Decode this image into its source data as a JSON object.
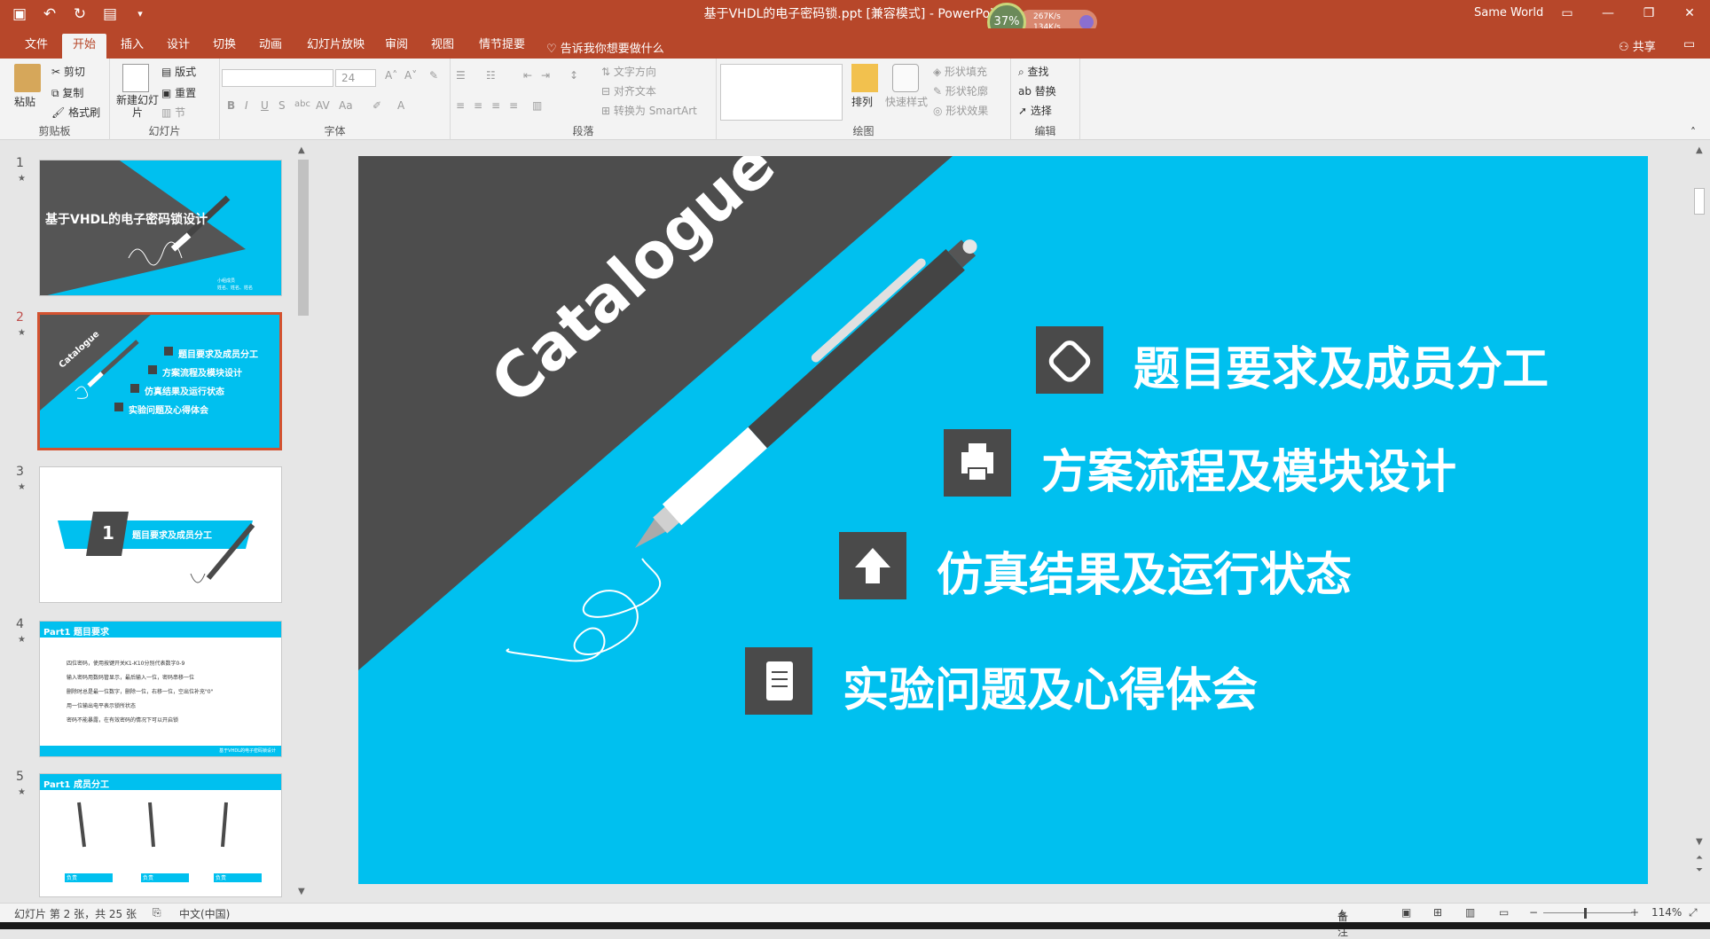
{
  "window": {
    "title": "基于VHDL的电子密码锁.ppt [兼容模式]  -  PowerPoint",
    "user": "Same World",
    "speed": {
      "percent": "37%",
      "up": "267K/s",
      "down": "134K/s"
    }
  },
  "tabs": [
    "文件",
    "开始",
    "插入",
    "设计",
    "切换",
    "动画",
    "幻灯片放映",
    "审阅",
    "视图",
    "情节提要"
  ],
  "active_tab": "开始",
  "tell_me": "告诉我你想要做什么",
  "share": "共享",
  "ribbon": {
    "clipboard": {
      "label": "剪贴板",
      "paste": "粘贴",
      "cut": "剪切",
      "copy": "复制",
      "format": "格式刷"
    },
    "slides": {
      "label": "幻灯片",
      "new_slide": "新建幻灯片",
      "layout": "版式",
      "reset": "重置",
      "section": "节"
    },
    "font": {
      "label": "字体",
      "size": "24"
    },
    "paragraph": {
      "label": "段落",
      "text_dir": "文字方向",
      "align_text": "对齐文本",
      "smartart": "转换为 SmartArt"
    },
    "drawing": {
      "label": "绘图",
      "arrange": "排列",
      "quick_styles": "快速样式",
      "fill": "形状填充",
      "outline": "形状轮廓",
      "effects": "形状效果"
    },
    "editing": {
      "label": "编辑",
      "find": "查找",
      "replace": "替换",
      "select": "选择"
    }
  },
  "thumbnails": [
    {
      "num": "1",
      "title": "基于VHDL的电子密码锁设计",
      "sub1": "小组成员",
      "sub2": "姓名、姓名、姓名"
    },
    {
      "num": "2",
      "label": "Catalogue",
      "items": [
        "题目要求及成员分工",
        "方案流程及模块设计",
        "仿真结果及运行状态",
        "实验问题及心得体会"
      ]
    },
    {
      "num": "3",
      "badge": "1",
      "title": "题目要求及成员分工"
    },
    {
      "num": "4",
      "header": "Part1 题目要求",
      "bullets": [
        "四位密码，使用按键开关K1-K10分别代表数字0-9",
        "输入密码用数码管显示，最后输入一位，密码串移一位",
        "删除时总是最一位数字，删除一位，右移一位，空出位补充\"0\"",
        "用一位输出电平表示锁所状态",
        "密码不能暴露，在有效密码的情况下可以开启锁"
      ],
      "footer": "基于VHDL的电子密码锁设计"
    },
    {
      "num": "5",
      "header": "Part1 成员分工",
      "members": [
        "负责",
        "负责",
        "负责"
      ]
    }
  ],
  "slide": {
    "catalogue": "Catalogue",
    "items": [
      {
        "icon": "paperclip-icon",
        "text": "题目要求及成员分工"
      },
      {
        "icon": "printer-icon",
        "text": "方案流程及模块设计"
      },
      {
        "icon": "upload-icon",
        "text": "仿真结果及运行状态"
      },
      {
        "icon": "notebook-icon",
        "text": "实验问题及心得体会"
      }
    ]
  },
  "status": {
    "slide_info": "幻灯片 第 2 张，共 25 张",
    "language": "中文(中国)",
    "notes": "备注",
    "zoom": "114%"
  },
  "colors": {
    "accent": "#b7472a",
    "slide_bg": "#00c0ef",
    "dark": "#4d4d4d"
  }
}
